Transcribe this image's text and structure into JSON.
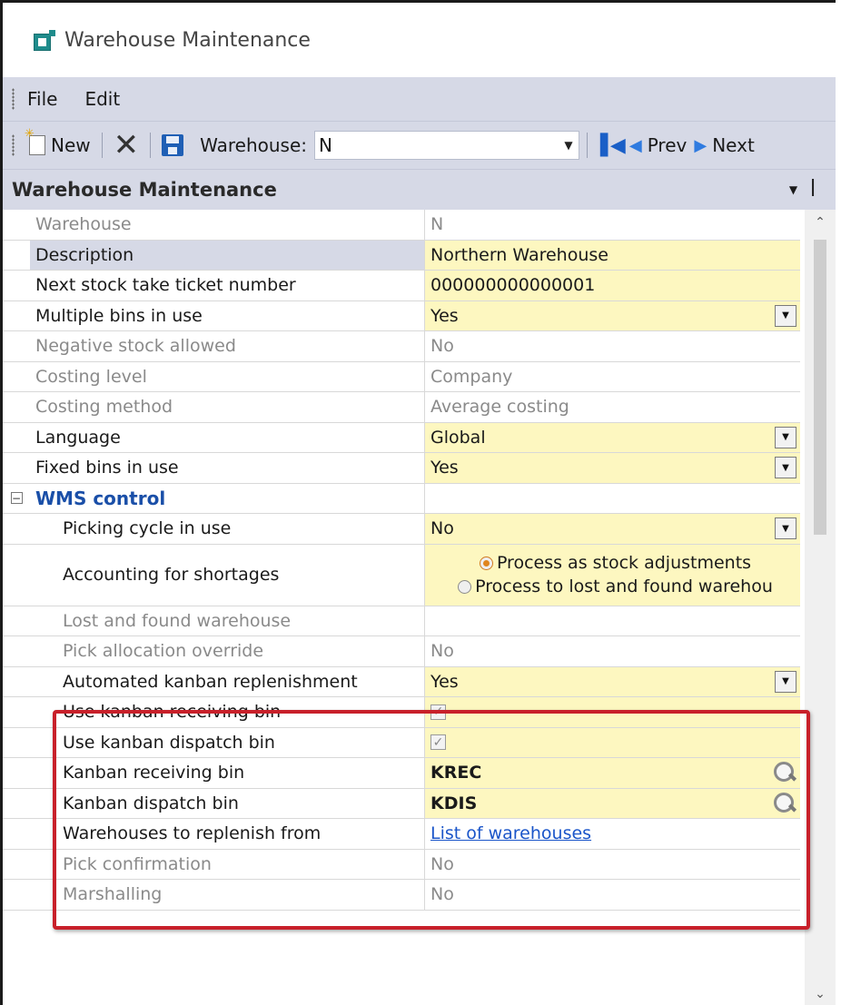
{
  "window": {
    "title": "Warehouse Maintenance"
  },
  "menu": {
    "items": [
      "File",
      "Edit"
    ]
  },
  "toolbar": {
    "new_label": "New",
    "warehouse_label": "Warehouse:",
    "warehouse_value": "N",
    "prev_label": "Prev",
    "next_label": "Next"
  },
  "panel": {
    "title": "Warehouse Maintenance"
  },
  "fields": {
    "warehouse": {
      "label": "Warehouse",
      "value": "N"
    },
    "description": {
      "label": "Description",
      "value": "Northern Warehouse"
    },
    "next_ticket": {
      "label": "Next stock take ticket number",
      "value": "000000000000001"
    },
    "multiple_bins": {
      "label": "Multiple bins in use",
      "value": "Yes"
    },
    "negative_stock": {
      "label": "Negative stock allowed",
      "value": "No"
    },
    "costing_level": {
      "label": "Costing level",
      "value": "Company"
    },
    "costing_method": {
      "label": "Costing method",
      "value": "Average costing"
    },
    "language": {
      "label": "Language",
      "value": "Global"
    },
    "fixed_bins": {
      "label": "Fixed bins in use",
      "value": "Yes"
    },
    "wms_group": {
      "label": "WMS control"
    },
    "picking_cycle": {
      "label": "Picking cycle in use",
      "value": "No"
    },
    "shortages": {
      "label": "Accounting for shortages",
      "option1": "Process as stock adjustments",
      "option2": "Process to lost and found warehou"
    },
    "lost_found": {
      "label": "Lost and found warehouse",
      "value": ""
    },
    "pick_override": {
      "label": "Pick allocation override",
      "value": "No"
    },
    "auto_kanban": {
      "label": "Automated kanban replenishment",
      "value": "Yes"
    },
    "use_recv_bin": {
      "label": "Use kanban receiving bin",
      "checked": true
    },
    "use_disp_bin": {
      "label": "Use kanban dispatch bin",
      "checked": true
    },
    "recv_bin": {
      "label": "Kanban receiving bin",
      "value": "KREC"
    },
    "disp_bin": {
      "label": "Kanban dispatch bin",
      "value": "KDIS"
    },
    "replenish_from": {
      "label": "Warehouses to replenish from",
      "value": "List of warehouses"
    },
    "pick_confirm": {
      "label": "Pick confirmation",
      "value": "No"
    },
    "marshalling": {
      "label": "Marshalling",
      "value": "No"
    }
  },
  "colors": {
    "editable_bg": "#fdf7c0",
    "toolbar_bg": "#d6d9e6",
    "highlight": "#c8202a",
    "group_text": "#1a4fa8",
    "link": "#1a55c9"
  }
}
